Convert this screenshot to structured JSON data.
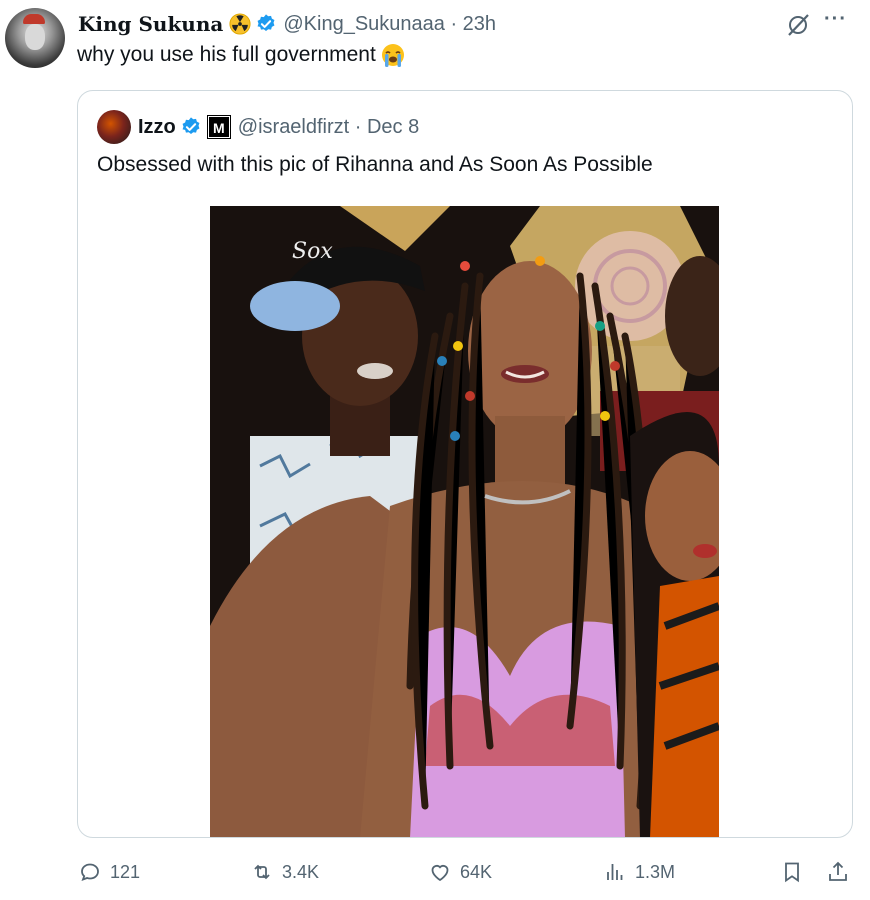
{
  "tweet": {
    "display_name": "King Sukuna",
    "handle_time": "@King_Sukunaaa · 23h",
    "text": "why you use his full government",
    "emoji": "loudly-crying-face",
    "badges": [
      "radioactive-icon",
      "verified-icon"
    ]
  },
  "quoted_tweet": {
    "display_name": "Izzo",
    "affiliate_badge": "M",
    "handle_time": "@israeldfirzt · Dec 8",
    "text": "Obsessed with this pic of Rihanna and As Soon As Possible",
    "image": "photo-of-two-women-and-a-man-posing"
  },
  "actions": {
    "replies": "121",
    "reposts": "3.4K",
    "likes": "64K",
    "views": "1.3M"
  },
  "colors": {
    "text_primary": "#0f1419",
    "text_secondary": "#536471",
    "verified_blue": "#1d9bf0",
    "border": "#cfd9de"
  }
}
